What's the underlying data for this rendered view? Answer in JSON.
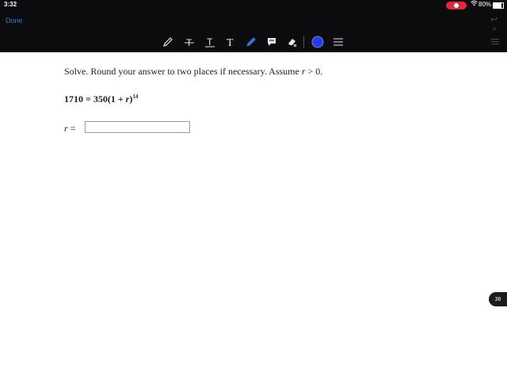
{
  "status": {
    "time": "3:32",
    "battery": "80%",
    "battery_level": 0.8
  },
  "nav": {
    "done_label": "Done"
  },
  "toolbar": {
    "tools": [
      "pencil-icon",
      "strikethrough-icon",
      "underline-icon",
      "text-icon",
      "highlighter-icon",
      "comment-icon",
      "eraser-icon",
      "color-swatch",
      "menu-icon"
    ],
    "active_color": "#1f3dff"
  },
  "question": {
    "text_prefix": "Solve. Round your answer to two places if necessary. Assume ",
    "var": "r",
    "text_suffix": " > 0."
  },
  "equation": {
    "lhs": "1710",
    "rhs_prefix": " = 350(1 + ",
    "var": "r",
    "rhs_suffix": ")",
    "exponent": "14"
  },
  "answer": {
    "label_var": "r",
    "label_eq": " =",
    "value": ""
  },
  "page_badge": "36"
}
